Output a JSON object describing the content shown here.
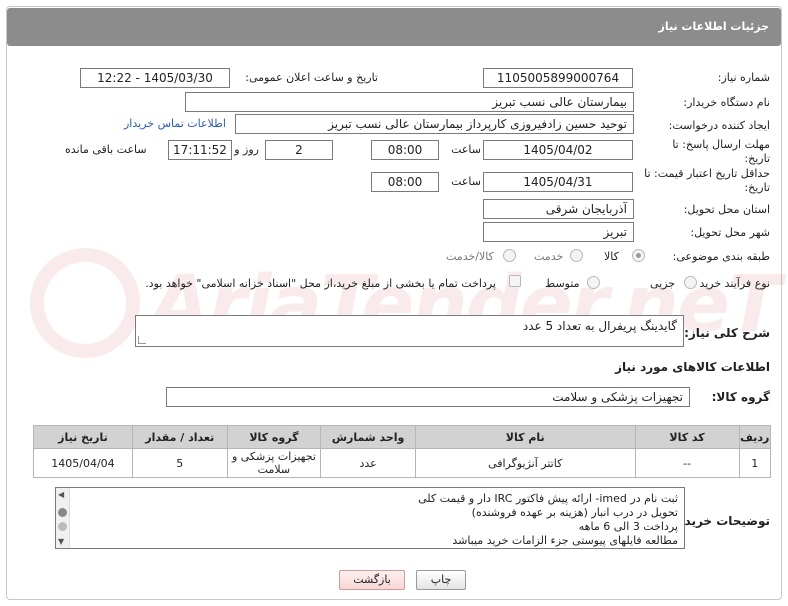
{
  "header": {
    "title": "جزئیات اطلاعات نیاز"
  },
  "form": {
    "need_number_label": "شماره نیاز:",
    "need_number": "1105005899000764",
    "announce_datetime_label": "تاریخ و ساعت اعلان عمومی:",
    "announce_datetime": "1405/03/30 - 12:22",
    "buyer_org_label": "نام دستگاه خریدار:",
    "buyer_org": "بیمارستان عالی نسب تبریز",
    "requester_label": "ایجاد کننده درخواست:",
    "requester": "توحید حسین زادفیروزی کارپرداز بیمارستان عالی نسب تبریز",
    "buyer_contact_link": "اطلاعات تماس خریدار",
    "reply_deadline_label": "مهلت ارسال پاسخ: تا تاریخ:",
    "reply_deadline_date": "1405/04/02",
    "time_label": "ساعت",
    "reply_deadline_time": "08:00",
    "days_value": "2",
    "days_label": "روز و",
    "remaining_time": "17:11:52",
    "remaining_label": "ساعت باقی مانده",
    "price_validity_label": "حداقل تاریخ اعتبار قیمت: تا تاریخ:",
    "price_validity_date": "1405/04/31",
    "price_validity_time": "08:00",
    "delivery_province_label": "استان محل تحویل:",
    "delivery_province": "آذربایجان شرقی",
    "delivery_city_label": "شهر محل تحویل:",
    "delivery_city": "تبریز",
    "category_label": "طبقه بندی موضوعی:",
    "category_options": [
      "کالا",
      "خدمت",
      "کالا/خدمت"
    ],
    "process_label": "نوع فرآیند خرید :",
    "process_options": [
      "جزیی",
      "متوسط"
    ],
    "payment_note": "پرداخت تمام یا بخشی از مبلغ خرید،از محل \"اسناد خزانه اسلامی\" خواهد بود."
  },
  "description": {
    "label": "شرح کلی نیاز:",
    "text": "گایدینگ پریفرال به تعداد 5 عدد"
  },
  "goods_section": {
    "title": "اطلاعات کالاهای مورد نیاز",
    "group_label": "گروه کالا:",
    "group_value": "تجهیزات پزشکی و سلامت"
  },
  "table": {
    "headers": [
      "ردیف",
      "کد کالا",
      "نام کالا",
      "واحد شمارش",
      "گروه کالا",
      "تعداد / مقدار",
      "تاریخ نیاز"
    ],
    "rows": [
      [
        "1",
        "--",
        "کاتتر آنژیوگرافی",
        "عدد",
        "تجهیزات پزشکی و سلامت",
        "5",
        "1405/04/04"
      ]
    ]
  },
  "buyer_notes": {
    "label": "توضیحات خریدار:",
    "lines": [
      "ثبت نام در imed- ارائه پیش فاکتور IRC دار و قیمت کلی",
      "تحویل در درب انبار (هزینه بر عهده فروشنده)",
      "پرداخت  3 الی 6 ماهه",
      "مطالعه فایلهای پیوستی جزء الزامات خرید میباشد"
    ]
  },
  "buttons": {
    "print": "چاپ",
    "back": "بازگشت"
  },
  "watermark": {
    "text": "AriaTender.neT"
  }
}
